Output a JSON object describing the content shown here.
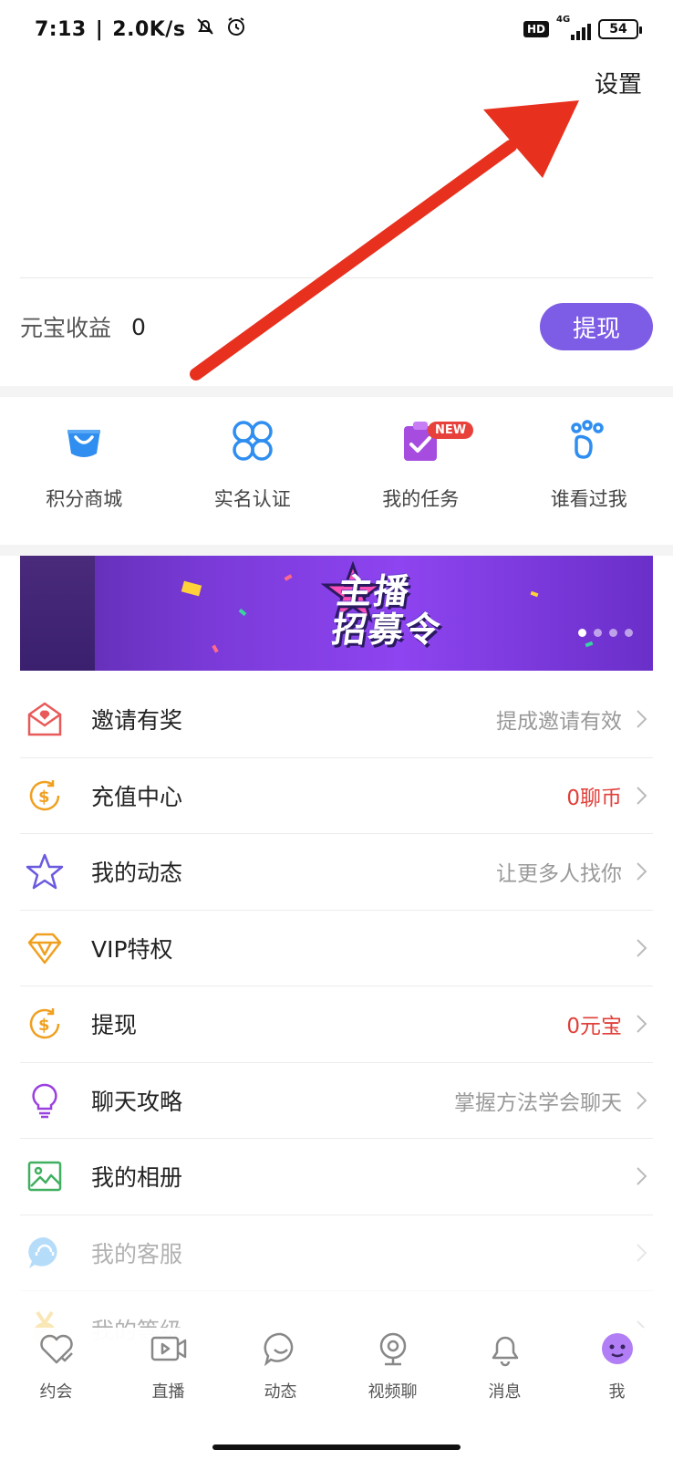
{
  "status_bar": {
    "time": "7:13",
    "speed": "2.0K/s",
    "hd": "HD",
    "network": "4G",
    "battery": "54"
  },
  "header": {
    "settings_label": "设置"
  },
  "earnings": {
    "label": "元宝收益",
    "value": "0",
    "withdraw_label": "提现"
  },
  "quick_actions": [
    {
      "label": "积分商城",
      "icon": "shopping-bag-icon",
      "color": "#2f8ef0"
    },
    {
      "label": "实名认证",
      "icon": "four-circles-icon",
      "color": "#2f8ef0"
    },
    {
      "label": "我的任务",
      "icon": "clipboard-check-icon",
      "color": "#a64de0",
      "badge": "NEW"
    },
    {
      "label": "谁看过我",
      "icon": "paw-icon",
      "color": "#2f8ef0"
    }
  ],
  "banner": {
    "title_line1": "主播",
    "title_line2": "招募令"
  },
  "menu": [
    {
      "label": "邀请有奖",
      "hint": "提成邀请有效",
      "hint_style": "gray",
      "icon": "envelope-heart-icon",
      "color": "#e85a5a"
    },
    {
      "label": "充值中心",
      "hint": "0聊币",
      "hint_style": "red",
      "icon": "coin-recharge-icon",
      "color": "#f0a020"
    },
    {
      "label": "我的动态",
      "hint": "让更多人找你",
      "hint_style": "gray",
      "icon": "star-icon",
      "color": "#6a5ae0"
    },
    {
      "label": "VIP特权",
      "hint": "",
      "hint_style": "gray",
      "icon": "diamond-icon",
      "color": "#f0a020"
    },
    {
      "label": "提现",
      "hint": "0元宝",
      "hint_style": "red",
      "icon": "coin-withdraw-icon",
      "color": "#f0a020"
    },
    {
      "label": "聊天攻略",
      "hint": "掌握方法学会聊天",
      "hint_style": "gray",
      "icon": "lightbulb-icon",
      "color": "#9a40e0"
    },
    {
      "label": "我的相册",
      "hint": "",
      "hint_style": "gray",
      "icon": "photo-icon",
      "color": "#40b060"
    },
    {
      "label": "我的客服",
      "hint": "",
      "hint_style": "gray",
      "icon": "chat-service-icon",
      "color": "#2f9ef0"
    },
    {
      "label": "我的等级",
      "hint": "",
      "hint_style": "gray",
      "icon": "medal-icon",
      "color": "#f0c030"
    }
  ],
  "tabs": [
    {
      "label": "约会",
      "icon": "heart-check-icon"
    },
    {
      "label": "直播",
      "icon": "video-icon"
    },
    {
      "label": "动态",
      "icon": "smile-bubble-icon"
    },
    {
      "label": "视频聊",
      "icon": "webcam-icon"
    },
    {
      "label": "消息",
      "icon": "bell-icon"
    },
    {
      "label": "我",
      "icon": "face-icon",
      "active": true
    }
  ],
  "colors": {
    "accent": "#7d5ce6",
    "annotation_arrow": "#e8301e"
  }
}
